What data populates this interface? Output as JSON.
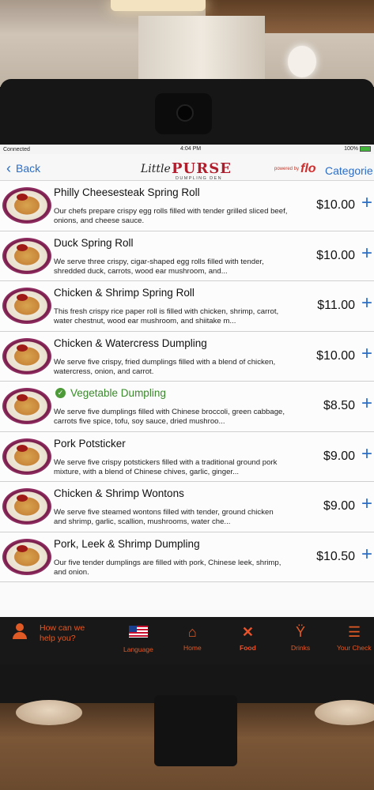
{
  "status": {
    "carrier": "Connected",
    "time": "4:04 PM",
    "battery": "100%"
  },
  "nav": {
    "back_label": "Back",
    "logo_script": "Little",
    "logo_main": "PURSE",
    "logo_sub": "DUMPLING DEN",
    "powered_by": "powered by",
    "flo": "flo",
    "categories_label": "Categorie"
  },
  "menu": [
    {
      "name": "Philly Cheesesteak Spring Roll",
      "desc": "Our chefs prepare crispy egg rolls filled with tender grilled sliced beef, onions, and cheese sauce.",
      "price": "$10.00",
      "veg": false
    },
    {
      "name": "Duck Spring Roll",
      "desc": "We serve three crispy, cigar-shaped egg rolls filled with tender, shredded duck, carrots, wood ear mushroom, and...",
      "price": "$10.00",
      "veg": false
    },
    {
      "name": "Chicken & Shrimp Spring Roll",
      "desc": "This fresh crispy rice paper roll is filled with chicken, shrimp, carrot, water chestnut, wood ear mushroom, and shiitake m...",
      "price": "$11.00",
      "veg": false
    },
    {
      "name": "Chicken & Watercress Dumpling",
      "desc": "We serve five crispy, fried dumplings filled with a blend of chicken, watercress, onion, and carrot.",
      "price": "$10.00",
      "veg": false
    },
    {
      "name": "Vegetable Dumpling",
      "desc": "We serve five dumplings filled with Chinese broccoli, green cabbage, carrots five spice, tofu, soy sauce, dried mushroo...",
      "price": "$8.50",
      "veg": true
    },
    {
      "name": "Pork Potsticker",
      "desc": "We serve five crispy potstickers filled with a traditional ground pork mixture, with a blend of Chinese chives, garlic, ginger...",
      "price": "$9.00",
      "veg": false
    },
    {
      "name": "Chicken & Shrimp Wontons",
      "desc": "We serve five steamed wontons filled with tender, ground chicken and shrimp, garlic, scallion, mushrooms, water che...",
      "price": "$9.00",
      "veg": false
    },
    {
      "name": "Pork, Leek & Shrimp Dumpling",
      "desc": "Our five tender dumplings are filled with pork, Chinese leek, shrimp, and onion.",
      "price": "$10.50",
      "veg": false
    }
  ],
  "tabbar": {
    "help_label": "How can we help you?",
    "language": "Language",
    "home": "Home",
    "food": "Food",
    "drinks": "Drinks",
    "your_check": "Your Check"
  },
  "icons": {
    "add": "+",
    "veg_badge": "✓",
    "back_chevron": "‹"
  },
  "colors": {
    "accent_blue": "#2a6ec8",
    "tab_orange": "#e05a26",
    "brand_red": "#b01e2d",
    "veg_green": "#3b8a2c"
  }
}
